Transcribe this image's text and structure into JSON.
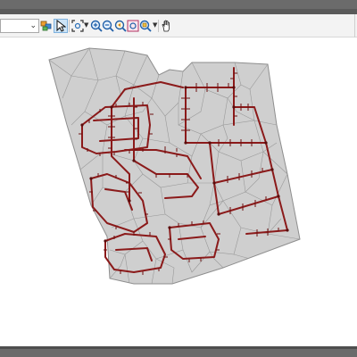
{
  "colors": {
    "window_frame": "#6b6b6b",
    "toolbar_bg": "#f3f3f3",
    "map_fill": "#cfcfcf",
    "polygon_edges": "#8e8e8e",
    "pipe_network": "#8b1a1a",
    "active_tool": "#cce4f7"
  },
  "toolbar": {
    "layer_combo_value": "",
    "tools": [
      {
        "icon": "layers-icon"
      },
      {
        "icon": "pointer-select-icon",
        "active": true
      },
      {
        "icon": "zoom-extent-icon",
        "dropdown": true
      },
      {
        "icon": "zoom-in-icon"
      },
      {
        "icon": "zoom-out-icon"
      },
      {
        "icon": "zoom-previous-icon"
      },
      {
        "icon": "zoom-layer-icon"
      },
      {
        "icon": "zoom-selection-icon",
        "dropdown": true
      },
      {
        "icon": "pan-hand-icon"
      }
    ]
  }
}
